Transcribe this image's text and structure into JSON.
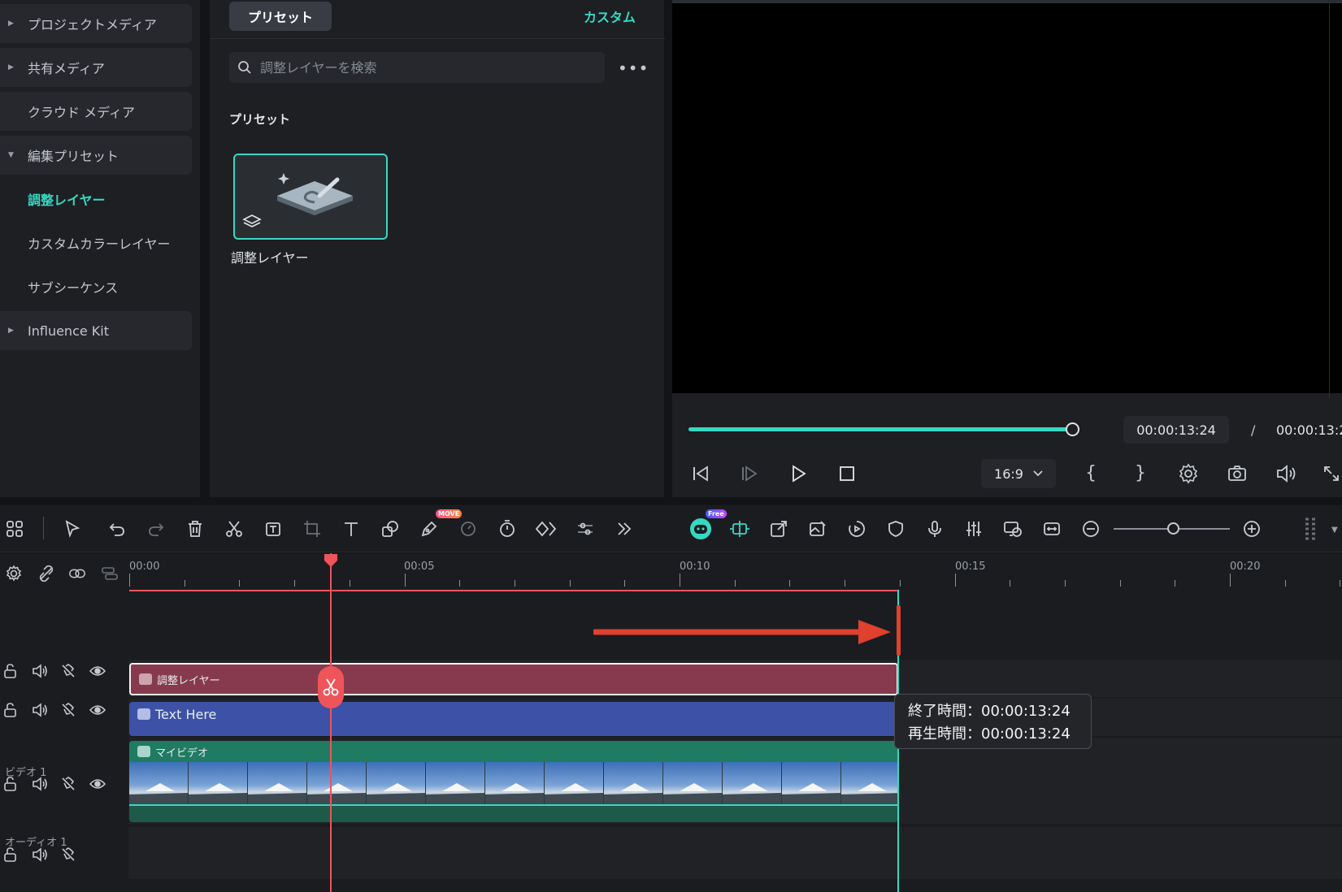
{
  "sidebar": {
    "items": [
      {
        "label": "プロジェクトメディア",
        "expandable": true,
        "expanded": false
      },
      {
        "label": "共有メディア",
        "expandable": true,
        "expanded": false
      },
      {
        "label": "クラウド メディア",
        "expandable": false
      },
      {
        "label": "編集プリセット",
        "expandable": true,
        "expanded": true
      },
      {
        "label": "調整レイヤー",
        "active": true
      },
      {
        "label": "カスタムカラーレイヤー"
      },
      {
        "label": "サブシーケンス"
      },
      {
        "label": "Influence Kit",
        "expandable": true,
        "expanded": false
      }
    ]
  },
  "preset_panel": {
    "tab_preset": "プリセット",
    "tab_custom": "カスタム",
    "search_placeholder": "調整レイヤーを検索",
    "more": "•••",
    "section_title": "プリセット",
    "card_label": "調整レイヤー"
  },
  "preview": {
    "current_time": "00:00:13:24",
    "separator": "/",
    "total_time": "00:00:13:2",
    "aspect_ratio": "16:9",
    "mark_in": "{",
    "mark_out": "}",
    "progress_fraction": 0.99
  },
  "toolbar": {
    "badge_move": "MOVE",
    "badge_free": "Free",
    "zoom_fraction": 0.52
  },
  "timeline": {
    "ruler": [
      "00:00",
      "00:05",
      "00:10",
      "00:15",
      "00:20"
    ],
    "playhead": "00:00:03:20",
    "tracks": {
      "video1_label": "ビデオ 1",
      "audio1_label": "オーディオ 1"
    },
    "clips": {
      "adjustment": "調整レイヤー",
      "text": "Text Here",
      "video": "マイビデオ"
    },
    "tooltip": {
      "end_time": "終了時間：00:00:13:24",
      "duration": "再生時間：00:00:13:24"
    }
  },
  "colors": {
    "accent": "#37d8c2",
    "playhead": "#f0545b",
    "adjustment_clip": "#873a4e",
    "text_clip": "#3d52a6",
    "video_clip": "#1f7b62",
    "arrow": "#e0402e"
  }
}
